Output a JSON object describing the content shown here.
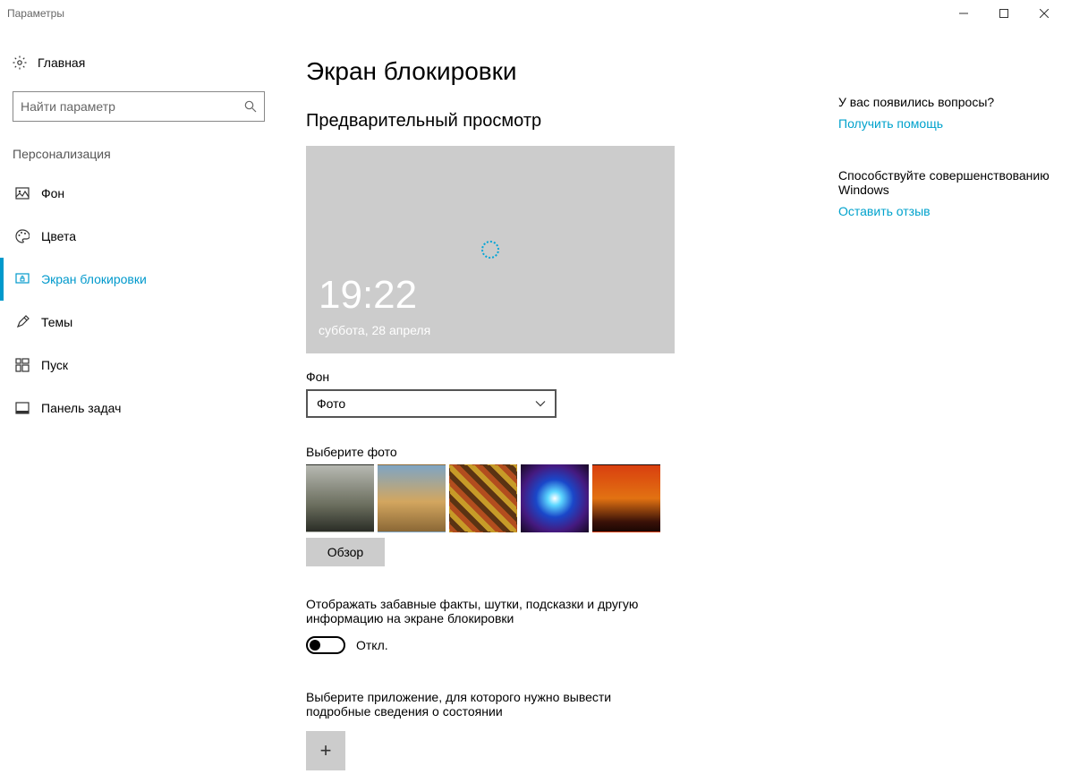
{
  "titlebar": {
    "title": "Параметры"
  },
  "sidebar": {
    "home": "Главная",
    "search_placeholder": "Найти параметр",
    "section": "Персонализация",
    "items": [
      {
        "label": "Фон"
      },
      {
        "label": "Цвета"
      },
      {
        "label": "Экран блокировки"
      },
      {
        "label": "Темы"
      },
      {
        "label": "Пуск"
      },
      {
        "label": "Панель задач"
      }
    ]
  },
  "main": {
    "title": "Экран блокировки",
    "preview_heading": "Предварительный просмотр",
    "preview_time": "19:22",
    "preview_date": "суббота, 28 апреля",
    "bg_label": "Фон",
    "bg_value": "Фото",
    "choose_photo": "Выберите фото",
    "browse": "Обзор",
    "toggle_label": "Отображать забавные факты, шутки, подсказки и другую информацию на экране блокировки",
    "toggle_state": "Откл.",
    "detail_label": "Выберите приложение, для которого нужно вывести подробные сведения о состоянии"
  },
  "right": {
    "q_heading": "У вас появились вопросы?",
    "help_link": "Получить помощь",
    "improve_heading": "Способствуйте совершенствованию Windows",
    "feedback_link": "Оставить отзыв"
  }
}
